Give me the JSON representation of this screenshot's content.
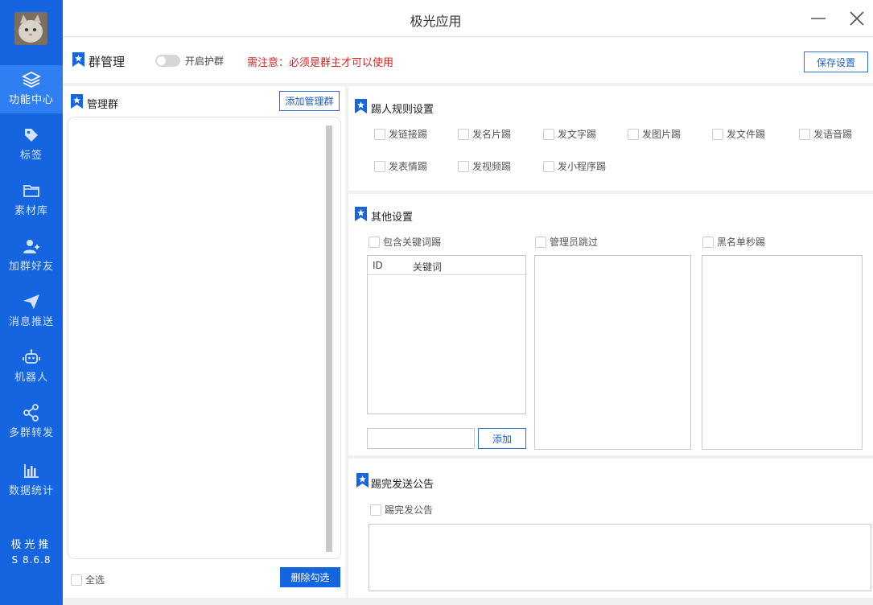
{
  "window": {
    "title": "极光应用"
  },
  "sidebar": {
    "items": [
      {
        "label": "功能中心",
        "icon": "layers-icon",
        "active": true
      },
      {
        "label": "标签",
        "icon": "tag-icon",
        "active": false
      },
      {
        "label": "素材库",
        "icon": "folder-icon",
        "active": false
      },
      {
        "label": "加群好友",
        "icon": "add-user-icon",
        "active": false
      },
      {
        "label": "消息推送",
        "icon": "paper-plane-icon",
        "active": false
      },
      {
        "label": "机器人",
        "icon": "robot-icon",
        "active": false
      },
      {
        "label": "多群转发",
        "icon": "share-icon",
        "active": false
      },
      {
        "label": "数据统计",
        "icon": "bar-chart-icon",
        "active": false
      }
    ],
    "brand": "极光推",
    "version": "S 8.6.8"
  },
  "header": {
    "title": "群管理",
    "toggle_label": "开启护群",
    "toggle_on": false,
    "notice": "需注意：必须是群主才可以使用",
    "save_label": "保存设置"
  },
  "left": {
    "title": "管理群",
    "add_label": "添加管理群",
    "select_all": "全选",
    "delete_label": "删除勾选"
  },
  "kick": {
    "title": "踢人规则设置",
    "rules": [
      "发链接踢",
      "发名片踢",
      "发文字踢",
      "发图片踢",
      "发文件踢",
      "发语音踢",
      "发表情踢",
      "发视频踢",
      "发小程序踢"
    ]
  },
  "other": {
    "title": "其他设置",
    "keyword_kick": "包含关键词踢",
    "admin_skip": "管理员跳过",
    "blacklist": "黑名单秒踢",
    "table_headers": [
      "ID",
      "关键词"
    ],
    "add_label": "添加"
  },
  "announce": {
    "title": "踢完发送公告",
    "checkbox_label": "踢完发公告"
  },
  "colors": {
    "sidebar": "#1565e0",
    "active": "#2f7ff2",
    "notice": "#dd2222",
    "accent": "#1e5fc9"
  }
}
